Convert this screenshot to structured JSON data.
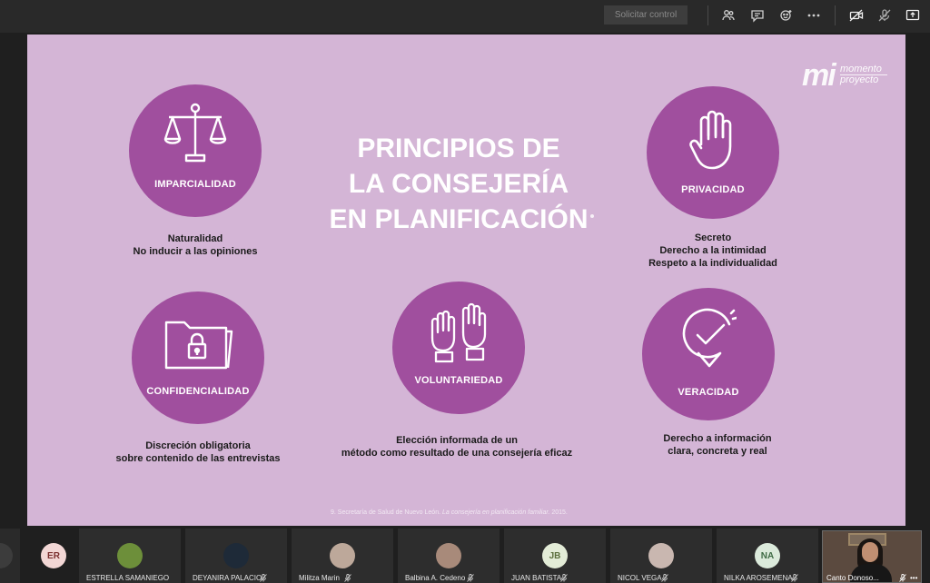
{
  "toolbar": {
    "request_control_label": "Solicitar control"
  },
  "slide": {
    "title_lines": [
      "PRINCIPIOS DE",
      "LA CONSEJERÍA",
      "EN PLANIFICACIÓN"
    ],
    "logo": {
      "mark": "mi",
      "line1": "momento",
      "line2": "proyecto"
    },
    "principles": [
      {
        "label": "IMPARCIALIDAD",
        "icon": "scales-icon",
        "desc": [
          "Naturalidad",
          "No inducir a las opiniones"
        ]
      },
      {
        "label": "PRIVACIDAD",
        "icon": "hand-icon",
        "desc": [
          "Secreto",
          "Derecho a la intimidad",
          "Respeto a la individualidad"
        ]
      },
      {
        "label": "CONFIDENCIALIDAD",
        "icon": "folder-lock-icon",
        "desc": [
          "Discreción obligatoria",
          "sobre contenido de las entrevistas"
        ]
      },
      {
        "label": "VOLUNTARIEDAD",
        "icon": "raised-hands-icon",
        "desc": [
          "Elección informada de un",
          "método como resultado de una consejería eficaz"
        ]
      },
      {
        "label": "VERACIDAD",
        "icon": "check-badge-icon",
        "desc": [
          "Derecho a información",
          "clara, concreta y real"
        ]
      }
    ],
    "footnote_prefix": "9. Secretaría de Salud de Nuevo León.",
    "footnote_title": "La consejería en planificación familiar.",
    "footnote_year": "2015."
  },
  "participants": [
    {
      "initials": "ER",
      "name": "",
      "avatar_color": "#f2d7d5",
      "initials_color": "#7a2e2e"
    },
    {
      "initials": "",
      "name": "ESTRELLA SAMANIEGO",
      "avatar_color": "#6d8f3a"
    },
    {
      "initials": "",
      "name": "DEYANIRA PALACIO",
      "avatar_color": "#1e2a38"
    },
    {
      "initials": "",
      "name": "Militza Marin",
      "avatar_color": "#bda89a"
    },
    {
      "initials": "",
      "name": "Balbina A. Cedeno",
      "avatar_color": "#a88a7a"
    },
    {
      "initials": "JB",
      "name": "JUAN BATISTA",
      "avatar_color": "#e3ecd7",
      "initials_color": "#5a6e3b"
    },
    {
      "initials": "",
      "name": "NICOL VEGA",
      "avatar_color": "#c9b7b0"
    },
    {
      "initials": "NA",
      "name": "NILKA AROSEMENA",
      "avatar_color": "#dbeadb",
      "initials_color": "#3f6b45"
    }
  ],
  "self_video": {
    "name": "Canto Donoso..."
  },
  "colors": {
    "slide_bg": "#d4b5d6",
    "circle": "#a04f9e",
    "app_bg": "#1f1f1f"
  }
}
